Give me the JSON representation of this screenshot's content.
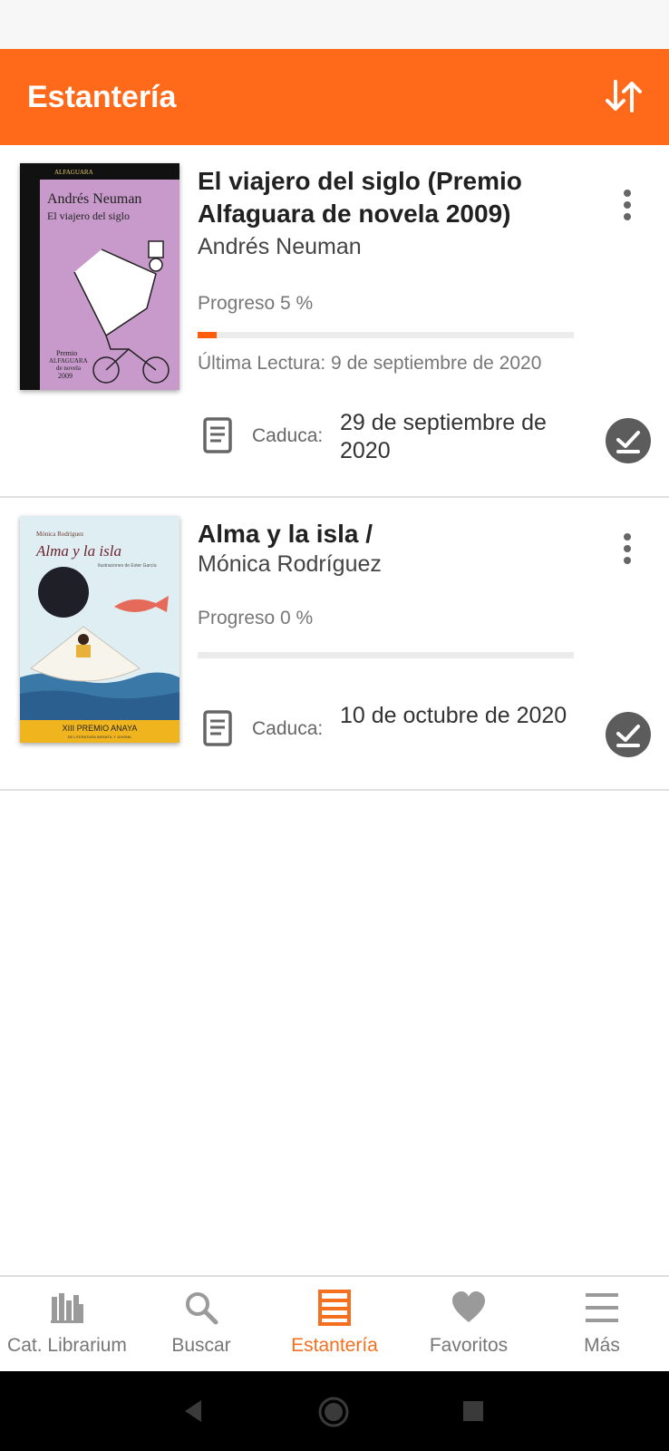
{
  "app_bar": {
    "title": "Estantería",
    "sort_icon": "sort-arrows-icon"
  },
  "books": [
    {
      "title": "El viajero del siglo (Premio Alfaguara de novela 2009)",
      "author": "Andrés Neuman",
      "progress_label": "Progreso 5 %",
      "progress": 0.05,
      "last_read": "Última Lectura: 9 de septiembre de 2020",
      "expiry_label": "Caduca:",
      "expiry_date": "29 de septiembre de 2020",
      "cover": {
        "publisher": "ALFAGUARA",
        "author": "Andrés Neuman",
        "title": "El viajero del siglo",
        "badge_line1": "Premio",
        "badge_line2": "ALFAGUARA",
        "badge_line3": "de novela",
        "badge_year": "2009",
        "color": "#c79acb"
      }
    },
    {
      "title": "Alma y la isla /",
      "author": "Mónica Rodríguez",
      "progress_label": "Progreso 0 %",
      "progress": 0.0,
      "last_read": "",
      "expiry_label": "Caduca:",
      "expiry_date": "10 de octubre de 2020",
      "cover": {
        "author": "Mónica Rodríguez",
        "title": "Alma y la isla",
        "illustrator": "Ilustraciones de Ester García",
        "award": "XIII PREMIO ANAYA",
        "award_sub": "DE LITERATURA INFANTIL Y JUVENIL",
        "color": "#dfeef3"
      }
    }
  ],
  "bottom_nav": [
    {
      "label": "Cat. Librarium",
      "icon": "library-icon",
      "active": false
    },
    {
      "label": "Buscar",
      "icon": "search-icon",
      "active": false
    },
    {
      "label": "Estantería",
      "icon": "bookshelf-icon",
      "active": true
    },
    {
      "label": "Favoritos",
      "icon": "heart-icon",
      "active": false
    },
    {
      "label": "Más",
      "icon": "menu-icon",
      "active": false
    }
  ],
  "colors": {
    "accent": "#ff6a1a",
    "active_nav": "#f5701e"
  }
}
